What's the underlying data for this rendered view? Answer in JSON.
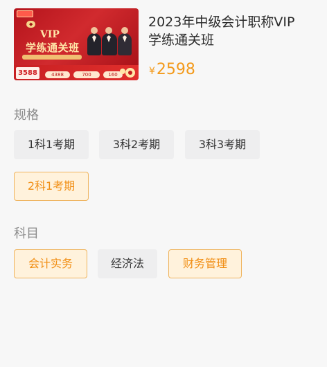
{
  "product": {
    "title": "2023年中级会计职称VIP\n学练通关班",
    "price_symbol": "¥",
    "price": "2598",
    "thumbnail": {
      "badge": "VIP",
      "headline": "学练通关班",
      "price_badge": "3588",
      "bottom_pills": [
        "4388",
        "700",
        "160"
      ]
    }
  },
  "spec": {
    "label": "规格",
    "options": [
      {
        "label": "1科1考期",
        "selected": false
      },
      {
        "label": "3科2考期",
        "selected": false
      },
      {
        "label": "3科3考期",
        "selected": false
      },
      {
        "label": "2科1考期",
        "selected": true
      }
    ]
  },
  "subject": {
    "label": "科目",
    "options": [
      {
        "label": "会计实务",
        "selected": true
      },
      {
        "label": "经济法",
        "selected": false
      },
      {
        "label": "财务管理",
        "selected": true
      }
    ]
  },
  "colors": {
    "accent": "#f39a1b",
    "selected_bg": "#fff2dc",
    "selected_border": "#efb35c",
    "chip_bg": "#eeeeef",
    "label_gray": "#8a8a8a"
  }
}
